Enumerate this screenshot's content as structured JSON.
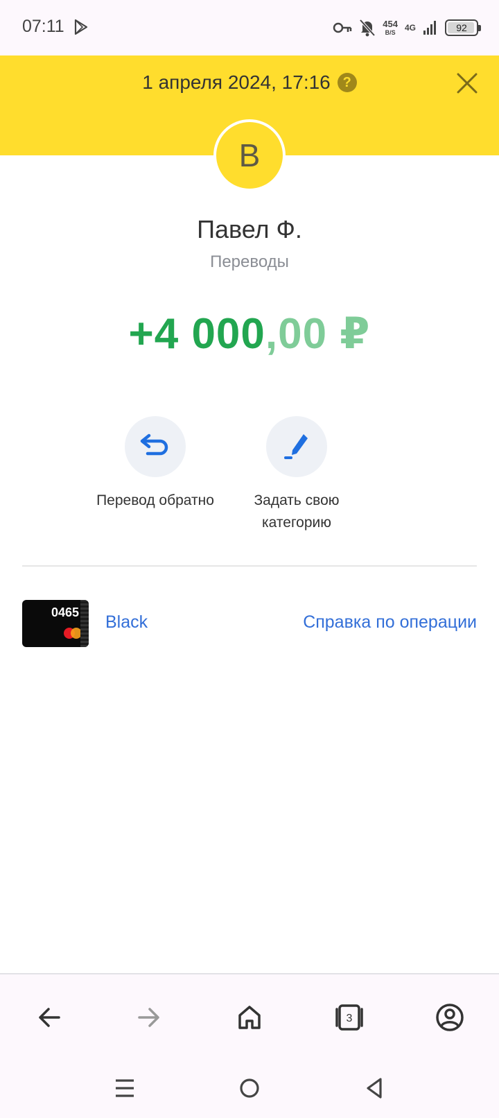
{
  "status_bar": {
    "time": "07:11",
    "speed_value": "454",
    "speed_unit": "B/S",
    "network": "4G",
    "battery": "92"
  },
  "header": {
    "datetime": "1 апреля 2024, 17:16",
    "help_symbol": "?",
    "background": "#ffdd2d"
  },
  "transaction": {
    "avatar_letter": "В",
    "name": "Павел Ф.",
    "category": "Переводы",
    "amount_integer": "+4 000",
    "amount_fraction": ",00 ₽",
    "amount_color": "#22a650"
  },
  "actions": [
    {
      "label": "Перевод обратно",
      "icon": "return-arrow-icon"
    },
    {
      "label": "Задать свою категорию",
      "icon": "pen-icon"
    }
  ],
  "card": {
    "last_digits": "0465",
    "name": "Black"
  },
  "links": {
    "help": "Справка по операции"
  },
  "browser": {
    "tabs_count": "3",
    "buttons": [
      "back-icon",
      "forward-icon",
      "home-icon",
      "tabs-icon",
      "profile-icon"
    ]
  },
  "system_nav": [
    "menu-icon",
    "home-circle-icon",
    "back-triangle-icon"
  ],
  "colors": {
    "link": "#336fd8",
    "amount_fraction": "#7fcc98"
  }
}
